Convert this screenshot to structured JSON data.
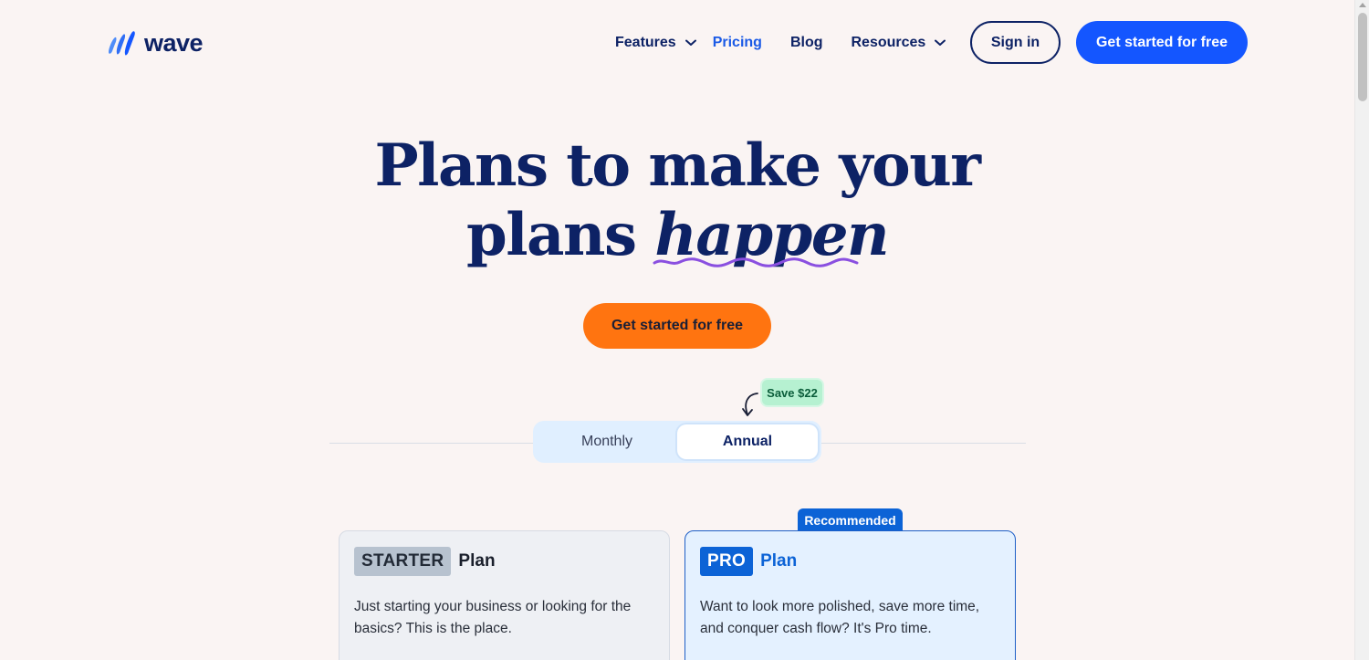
{
  "brand": {
    "name": "wave",
    "color": "#0d2265",
    "accent": "#1456ff"
  },
  "nav": {
    "items": [
      {
        "label": "Features",
        "dropdown": true,
        "active": false
      },
      {
        "label": "Pricing",
        "dropdown": false,
        "active": true
      },
      {
        "label": "Blog",
        "dropdown": false,
        "active": false
      },
      {
        "label": "Resources",
        "dropdown": true,
        "active": false
      }
    ],
    "sign_in": "Sign in",
    "cta": "Get started for free"
  },
  "hero": {
    "title_line1": "Plans to make your",
    "title_line2_prefix": "plans ",
    "title_line2_em": "happen",
    "cta": "Get started for free",
    "cta_color": "#ff7410"
  },
  "billing": {
    "save_badge": "Save $22",
    "options": [
      "Monthly",
      "Annual"
    ],
    "selected": "Annual"
  },
  "plans": [
    {
      "tag": "STARTER",
      "word": "Plan",
      "description": "Just starting your business or looking for the basics? This is the place.",
      "recommended": false
    },
    {
      "tag": "PRO",
      "word": "Plan",
      "description": "Want to look more polished, save more time, and conquer cash flow? It's Pro time.",
      "recommended": true,
      "badge": "Recommended"
    }
  ]
}
